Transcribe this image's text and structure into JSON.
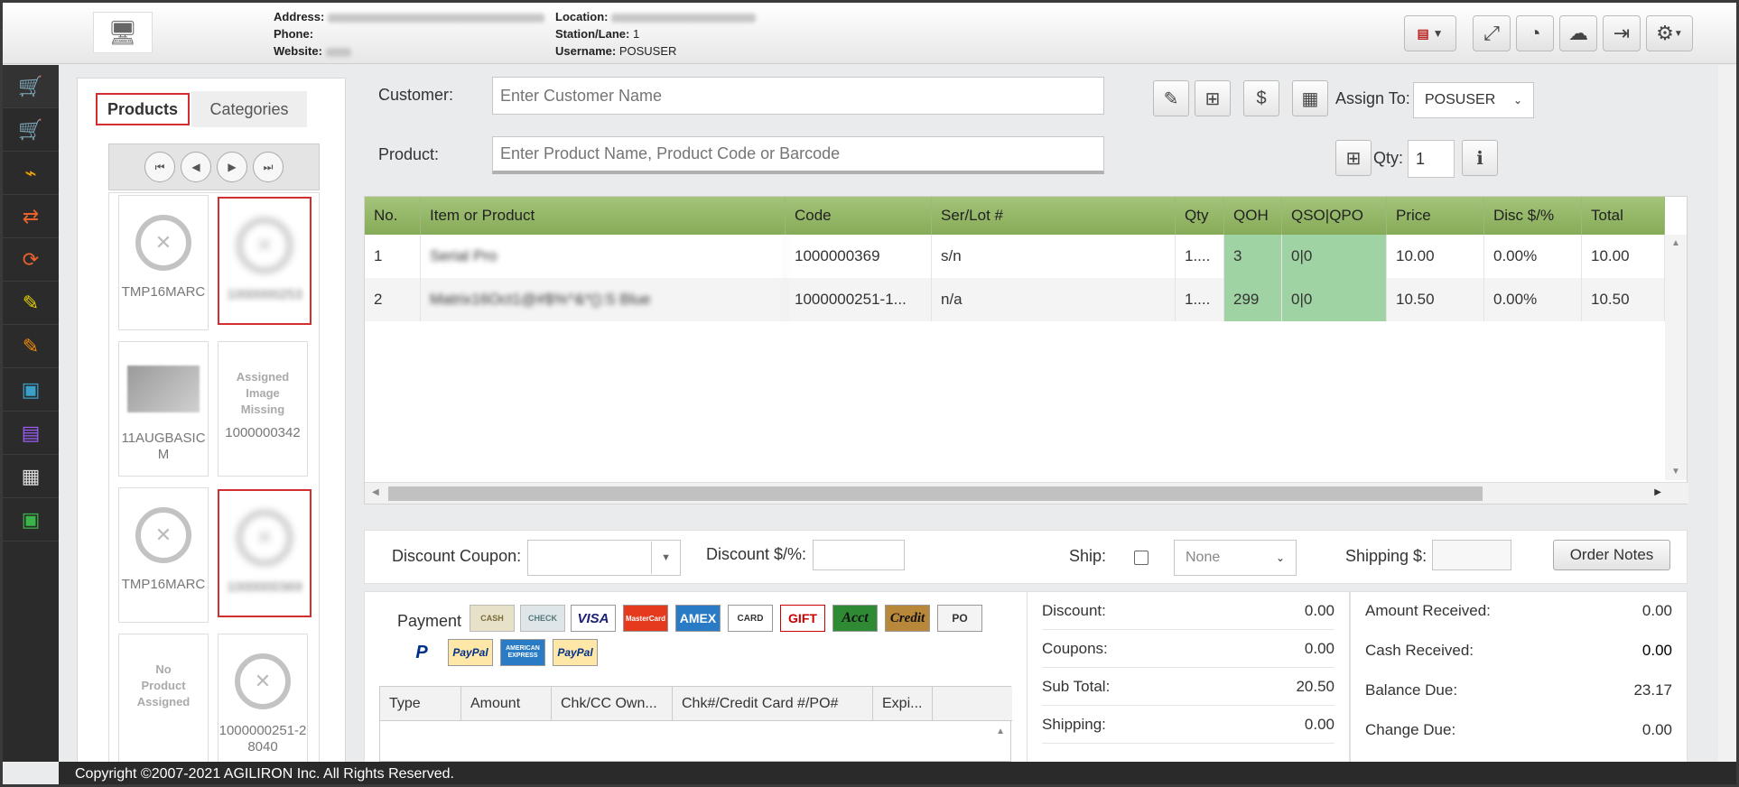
{
  "header": {
    "address_label": "Address:",
    "phone_label": "Phone:",
    "website_label": "Website:",
    "location_label": "Location:",
    "station_label": "Station/Lane:",
    "station_value": "1",
    "username_label": "Username:",
    "username_value": "POSUSER"
  },
  "sidebar": {
    "items": [
      "cart-green-icon",
      "cart-icon",
      "cart-swoosh-icon",
      "transfer-icon",
      "refresh-icon",
      "edit-yellow-icon",
      "edit-orange-icon",
      "cash-icon",
      "document-icon",
      "grid-icon",
      "register-icon"
    ]
  },
  "products_panel": {
    "tab_products": "Products",
    "tab_categories": "Categories",
    "tiles": [
      {
        "caption": "TMP16MARC",
        "type": "noimage"
      },
      {
        "caption": "1000000253",
        "type": "blurred"
      },
      {
        "caption": "11AUGBASICM",
        "type": "photo"
      },
      {
        "caption": "1000000342",
        "type": "missing",
        "missing_text": "Assigned Image Missing"
      },
      {
        "caption": "TMP16MARC",
        "type": "noimage"
      },
      {
        "caption": "1000000369",
        "type": "blurred"
      },
      {
        "caption": "",
        "type": "noproduct",
        "missing_text": "No Product Assigned"
      },
      {
        "caption": "1000000251-28040",
        "type": "noimage"
      }
    ]
  },
  "form": {
    "customer_label": "Customer:",
    "customer_placeholder": "Enter Customer Name",
    "product_label": "Product:",
    "product_placeholder": "Enter Product Name, Product Code or Barcode",
    "assign_to_label": "Assign To:",
    "assign_to_value": "POSUSER",
    "qty_label": "Qty:",
    "qty_value": "1"
  },
  "order_table": {
    "columns": [
      "No.",
      "Item or Product",
      "Code",
      "Ser/Lot #",
      "Qty",
      "QOH",
      "QSO|QPO",
      "Price",
      "Disc $/%",
      "Total"
    ],
    "rows": [
      {
        "no": "1",
        "item": "Serial Pro",
        "code": "1000000369",
        "serlot": "s/n",
        "qty": "1....",
        "qoh": "3",
        "qso": "0|0",
        "price": "10.00",
        "disc": "0.00%",
        "total": "10.00"
      },
      {
        "no": "2",
        "item": "Matrix16Oct1@#$%^&*():S Blue",
        "code": "1000000251-1...",
        "serlot": "n/a",
        "qty": "1....",
        "qoh": "299",
        "qso": "0|0",
        "price": "10.50",
        "disc": "0.00%",
        "total": "10.50"
      }
    ]
  },
  "discount_bar": {
    "coupon_label": "Discount Coupon:",
    "discount_label": "Discount $/%:",
    "ship_label": "Ship:",
    "ship_select": "None",
    "shipping_label": "Shipping $:",
    "order_notes": "Order Notes"
  },
  "payment": {
    "label": "Payment",
    "cards": [
      "CASH",
      "CHECK",
      "VISA",
      "MasterCard",
      "AMEX",
      "CARD",
      "GIFT",
      "Acct",
      "Credit",
      "PO",
      "P",
      "PayPal",
      "AMERICAN EXPRESS",
      "PayPal"
    ],
    "columns": [
      "Type",
      "Amount",
      "Chk/CC Own...",
      "Chk#/Credit Card #/PO#",
      "Expi..."
    ]
  },
  "summary_left": [
    {
      "label": "Discount:",
      "value": "0.00"
    },
    {
      "label": "Coupons:",
      "value": "0.00"
    },
    {
      "label": "Sub Total:",
      "value": "20.50"
    },
    {
      "label": "Shipping:",
      "value": "0.00"
    }
  ],
  "summary_right": [
    {
      "label": "Amount Received:",
      "value": "0.00"
    },
    {
      "label": "Cash Received:",
      "value": "0.00"
    },
    {
      "label": "Balance Due:",
      "value": "23.17"
    },
    {
      "label": "Change Due:",
      "value": "0.00"
    }
  ],
  "footer": {
    "copyright": "Copyright ©2007-2021 AGILIRON Inc. All Rights Reserved."
  },
  "colors": {
    "table_header": "#8db35f",
    "stock_cell": "#9fd3a3",
    "selection": "#d32f2f",
    "sidebar": "#2b2b2b"
  }
}
